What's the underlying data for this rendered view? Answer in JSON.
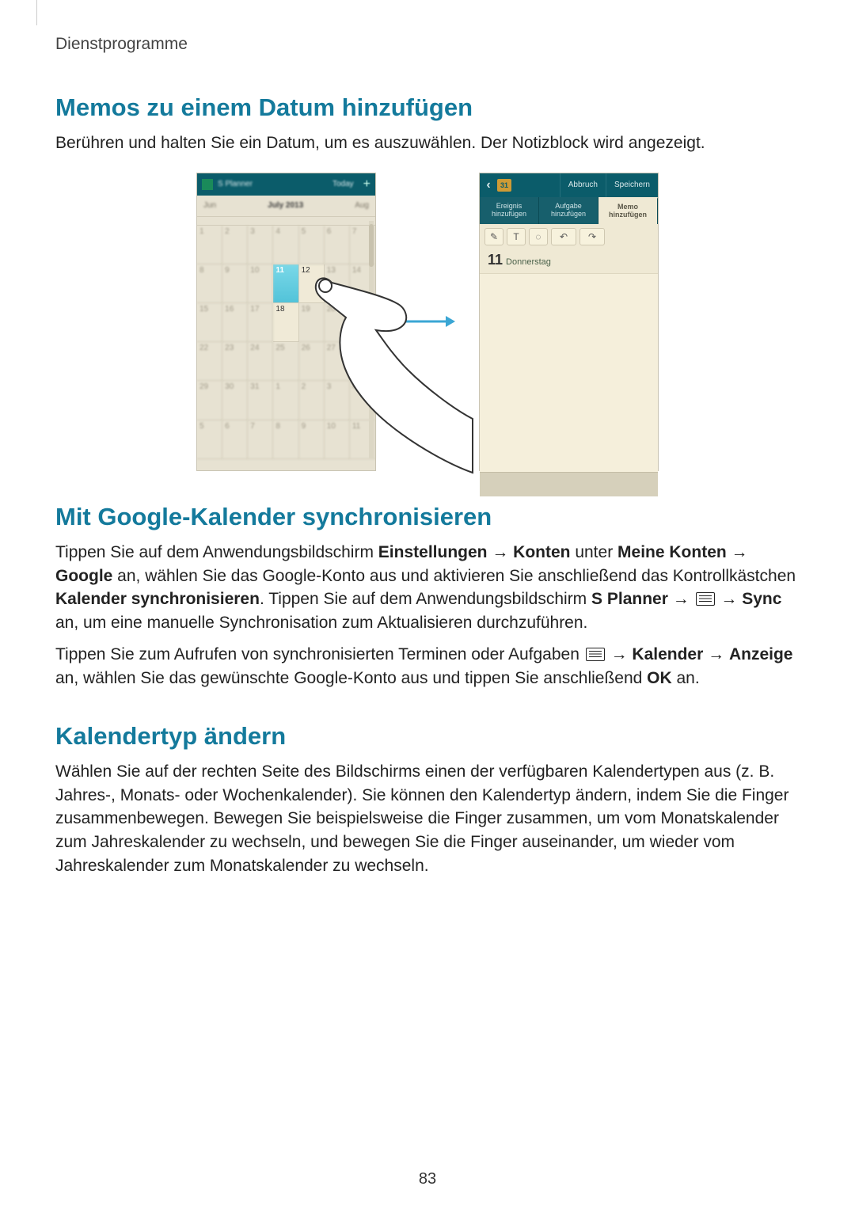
{
  "breadcrumb": "Dienstprogramme",
  "page_number": "83",
  "sections": {
    "s1": {
      "title": "Memos zu einem Datum hinzufügen",
      "p1": "Berühren und halten Sie ein Datum, um es auszuwählen. Der Notizblock wird angezeigt."
    },
    "s2": {
      "title": "Mit Google-Kalender synchronisieren",
      "p1_a": "Tippen Sie auf dem Anwendungsbildschirm ",
      "p1_b": "Einstellungen",
      "p1_c": " → ",
      "p1_d": "Konten",
      "p1_e": " unter ",
      "p1_f": "Meine Konten",
      "p1_g": " → ",
      "p1_h": "Google",
      "p1_i": " an, wählen Sie das Google-Konto aus und aktivieren Sie anschließend das Kontrollkästchen ",
      "p1_j": "Kalender synchronisieren",
      "p1_k": ". Tippen Sie auf dem Anwendungsbildschirm ",
      "p1_l": "S Planner",
      "p1_m": " → ",
      "p1_n": " → ",
      "p1_o": "Sync",
      "p1_p": " an, um eine manuelle Synchronisation zum Aktualisieren durchzuführen.",
      "p2_a": "Tippen Sie zum Aufrufen von synchronisierten Terminen oder Aufgaben ",
      "p2_b": " → ",
      "p2_c": "Kalender",
      "p2_d": " → ",
      "p2_e": "Anzeige",
      "p2_f": " an, wählen Sie das gewünschte Google-Konto aus und tippen Sie anschließend ",
      "p2_g": "OK",
      "p2_h": " an."
    },
    "s3": {
      "title": "Kalendertyp ändern",
      "p1": "Wählen Sie auf der rechten Seite des Bildschirms einen der verfügbaren Kalendertypen aus (z. B. Jahres-, Monats- oder Wochenkalender). Sie können den Kalendertyp ändern, indem Sie die Finger zusammenbewegen. Bewegen Sie beispielsweise die Finger zusammen, um vom Monatskalender zum Jahreskalender zu wechseln, und bewegen Sie die Finger auseinander, um wieder vom Jahreskalender zum Monatskalender zu wechseln."
    }
  },
  "left_shot": {
    "app_title": "S Planner",
    "today": "Today",
    "plus": "+",
    "prev_month": "Jun",
    "current_month": "July 2013",
    "next_month": "Aug",
    "selected_day": "11",
    "adjacent_day_right": "12",
    "below_day": "18"
  },
  "right_shot": {
    "header": {
      "back": "‹",
      "calendar_icon_num": "31",
      "cancel": "Abbruch",
      "save": "Speichern"
    },
    "tabs": {
      "t1": "Ereignis hinzufügen",
      "t2": "Aufgabe hinzufügen",
      "t3": "Memo hinzufügen"
    },
    "toolbar": {
      "pen": "✎",
      "text": "T",
      "eraser": "◌",
      "undo": "↶",
      "redo": "↷"
    },
    "date_num": "11",
    "date_day": "Donnerstag"
  }
}
